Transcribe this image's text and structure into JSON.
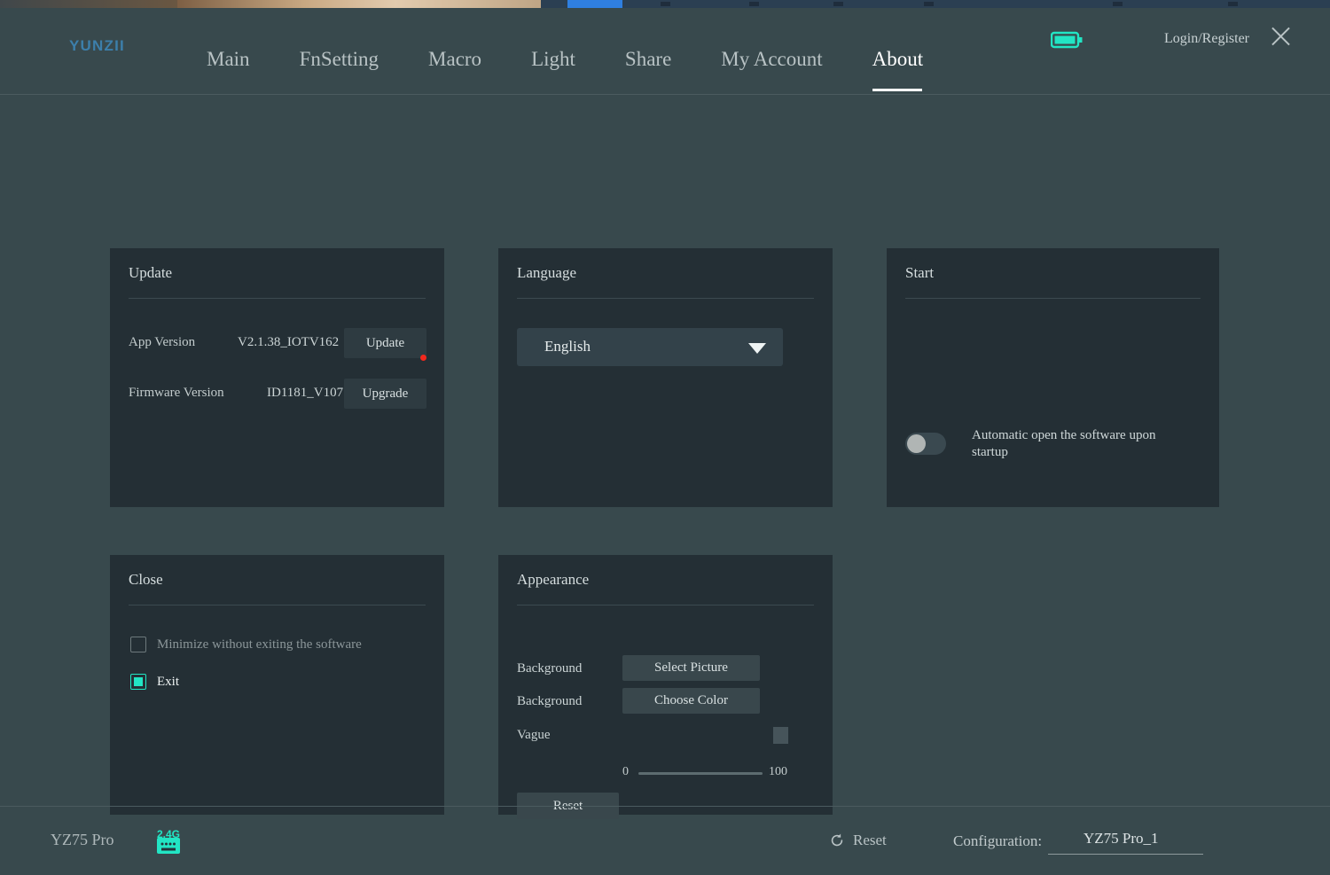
{
  "header": {
    "logo": "YUNZII",
    "nav": [
      {
        "label": "Main",
        "active": false
      },
      {
        "label": "FnSetting",
        "active": false
      },
      {
        "label": "Macro",
        "active": false
      },
      {
        "label": "Light",
        "active": false
      },
      {
        "label": "Share",
        "active": false
      },
      {
        "label": "My Account",
        "active": false
      },
      {
        "label": "About",
        "active": true
      }
    ],
    "battery_icon": "battery-icon",
    "login_register": "Login/Register",
    "close_icon": "close-icon",
    "accent_color": "#22e5c4",
    "logo_color": "#3c7fab"
  },
  "cards": {
    "update": {
      "title": "Update",
      "app_version_label": "App Version",
      "app_version_value": "V2.1.38_IOTV162",
      "update_button": "Update",
      "update_badge_color": "#f2281d",
      "firmware_version_label": "Firmware Version",
      "firmware_version_value": "ID1181_V107",
      "upgrade_button": "Upgrade"
    },
    "language": {
      "title": "Language",
      "selected": "English",
      "caret_icon": "chevron-down-icon"
    },
    "start": {
      "title": "Start",
      "toggle_state": "off",
      "toggle_label": "Automatic open the software upon startup"
    },
    "close": {
      "title": "Close",
      "minimize_label": "Minimize without exiting the software",
      "minimize_checked": false,
      "exit_label": "Exit",
      "exit_checked": true
    },
    "appearance": {
      "title": "Appearance",
      "background_picture_label": "Background",
      "select_picture_button": "Select Picture",
      "background_color_label": "Background",
      "choose_color_button": "Choose Color",
      "color_swatch": "#46545a",
      "vague_label": "Vague",
      "vague_min": "0",
      "vague_max": "100",
      "vague_value": 0,
      "reset_button": "Reset"
    }
  },
  "footer": {
    "device_name": "YZ75 Pro",
    "device_icon": "keyboard-24g-icon",
    "device_icon_text": "2.4G",
    "reset_icon": "refresh-icon",
    "reset_label": "Reset",
    "configuration_label": "Configuration:",
    "configuration_value": "YZ75 Pro_1"
  }
}
